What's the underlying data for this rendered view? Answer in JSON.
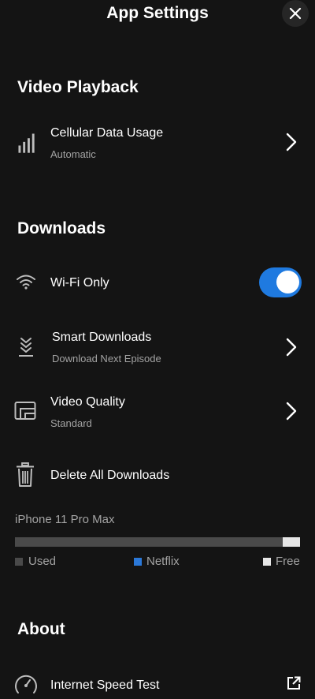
{
  "header": {
    "title": "App Settings"
  },
  "sections": {
    "video_playback": "Video Playback",
    "downloads": "Downloads",
    "about": "About"
  },
  "rows": {
    "cellular": {
      "title": "Cellular Data Usage",
      "subtitle": "Automatic"
    },
    "wifi": {
      "title": "Wi-Fi Only",
      "enabled": true
    },
    "smart_downloads": {
      "title": "Smart Downloads",
      "subtitle": "Download Next Episode"
    },
    "video_quality": {
      "title": "Video Quality",
      "subtitle": "Standard"
    },
    "delete_all": {
      "title": "Delete All Downloads"
    },
    "speed_test": {
      "title": "Internet Speed Test"
    }
  },
  "storage": {
    "device": "iPhone 11 Pro Max",
    "used_fraction": 0.94,
    "netflix_fraction": 0.0,
    "free_fraction": 0.06,
    "legend": {
      "used": "Used",
      "netflix": "Netflix",
      "free": "Free"
    },
    "colors": {
      "used": "#4a4a4a",
      "netflix": "#2b78d8",
      "free": "#e6e6e6"
    }
  },
  "colors": {
    "background": "#141414",
    "accent": "#1f7ae0",
    "subtext": "#a3a3a3"
  },
  "icons": {
    "close": "close-icon",
    "cellular": "signal-bars-icon",
    "wifi": "wifi-icon",
    "smart_downloads": "smart-downloads-icon",
    "video_quality": "video-quality-icon",
    "delete": "trash-icon",
    "speed_test": "speedometer-icon",
    "external": "external-link-icon",
    "chevron": "chevron-right-icon"
  }
}
